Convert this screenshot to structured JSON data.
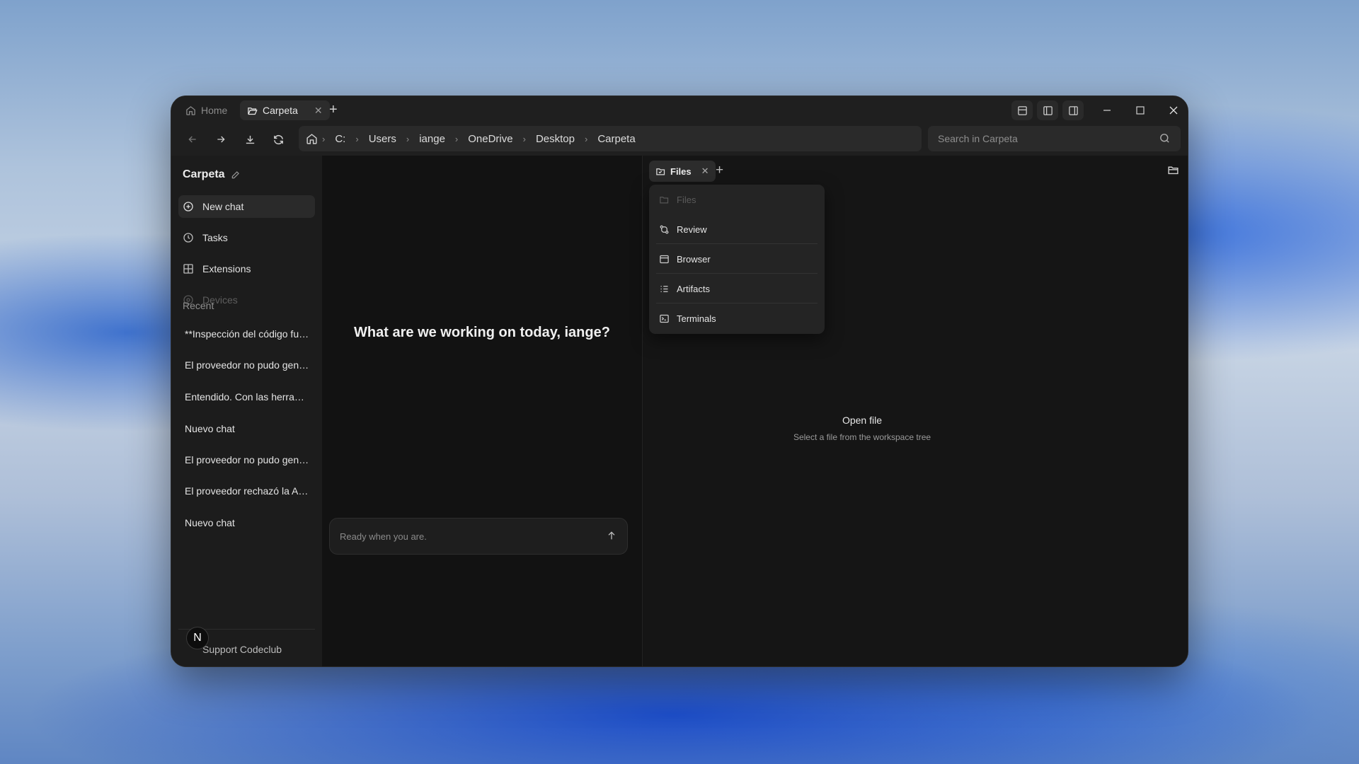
{
  "tabs": [
    {
      "label": "Home",
      "active": false
    },
    {
      "label": "Carpeta",
      "active": true
    }
  ],
  "breadcrumb": [
    "C:",
    "Users",
    "iange",
    "OneDrive",
    "Desktop",
    "Carpeta"
  ],
  "search": {
    "placeholder": "Search in Carpeta"
  },
  "sidebar": {
    "workspace_title": "Carpeta",
    "nav": [
      {
        "label": "New chat",
        "icon": "plus-circle-icon"
      },
      {
        "label": "Tasks",
        "icon": "clock-icon"
      },
      {
        "label": "Extensions",
        "icon": "grid-icon"
      },
      {
        "label": "Devices",
        "icon": "devices-icon"
      }
    ],
    "recent_label": "Recent",
    "recent": [
      "**Inspección del código fuente...",
      "El proveedor no pudo generar ...",
      "Entendido. Con las herramienta...",
      "Nuevo chat",
      "El proveedor no pudo generar ...",
      "El proveedor rechazó la API key...",
      "Nuevo chat"
    ],
    "avatar_letter": "N",
    "support_label": "Support Codeclub"
  },
  "chat": {
    "greeting": "What are we working on today, iange?",
    "composer_placeholder": "Ready when you are."
  },
  "panel": {
    "tab_label": "Files",
    "menu": [
      "Files",
      "Review",
      "Browser",
      "Artifacts",
      "Terminals"
    ],
    "empty_title": "Open file",
    "empty_subtitle": "Select a file from the workspace tree"
  },
  "colors": {
    "window_bg": "#161616",
    "sidebar_bg": "#1c1c1c",
    "accent_text": "#ececec"
  }
}
